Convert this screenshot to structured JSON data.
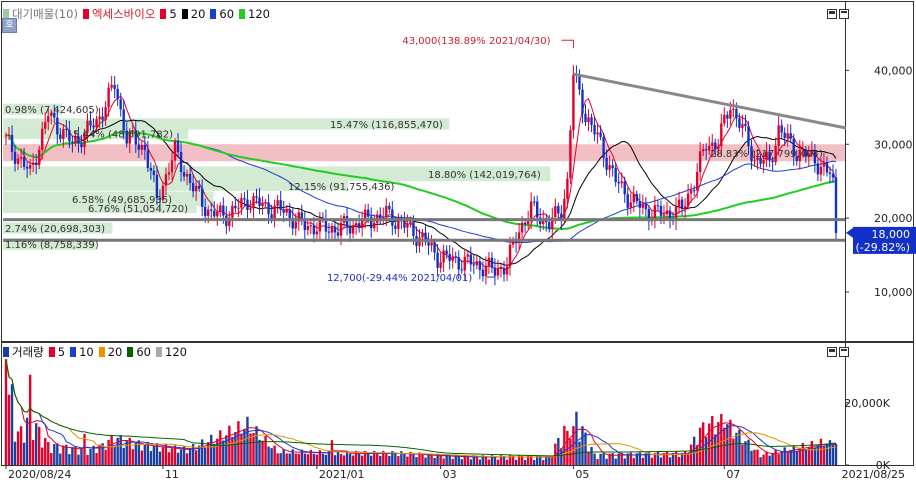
{
  "price_legend": [
    {
      "label": "대기매물(10)",
      "color": "#9ec89e"
    },
    {
      "label": "엑세스바이오",
      "color": "#e4002b"
    },
    {
      "label": "5",
      "color": "#e4002b"
    },
    {
      "label": "20",
      "color": "#000000"
    },
    {
      "label": "60",
      "color": "#1a3fd0"
    },
    {
      "label": "120",
      "color": "#22cc22"
    }
  ],
  "volume_legend": [
    {
      "label": "거래량",
      "color": "#1a3fa0"
    },
    {
      "label": "5",
      "color": "#e4002b"
    },
    {
      "label": "10",
      "color": "#1a3fd0"
    },
    {
      "label": "20",
      "color": "#e69500"
    },
    {
      "label": "60",
      "color": "#006600"
    },
    {
      "label": "120",
      "color": "#aaaaaa"
    }
  ],
  "side_tab": "호",
  "chart_data": [
    {
      "type": "candlestick",
      "title": "엑세스바이오",
      "y_ticks": [
        "10,000",
        "20,000",
        "30,000",
        "40,000"
      ],
      "y_tick_values": [
        10000,
        20000,
        30000,
        40000
      ],
      "ylim": [
        3500,
        47500
      ],
      "x_ticks": [
        "2020/08/24",
        "11",
        "2021/01",
        "03",
        "05",
        "07",
        "2021/08/25"
      ],
      "x_tick_index": [
        0,
        52,
        103,
        144,
        188,
        238,
        275
      ],
      "n_days": 275,
      "ohlc_path": [
        [
          0,
          30500
        ],
        [
          8,
          26000
        ],
        [
          14,
          34000
        ],
        [
          22,
          30000
        ],
        [
          30,
          33000
        ],
        [
          36,
          38000
        ],
        [
          40,
          31000
        ],
        [
          46,
          29500
        ],
        [
          50,
          22500
        ],
        [
          56,
          29000
        ],
        [
          62,
          24000
        ],
        [
          68,
          20500
        ],
        [
          74,
          20500
        ],
        [
          80,
          22500
        ],
        [
          86,
          21500
        ],
        [
          92,
          21000
        ],
        [
          98,
          19000
        ],
        [
          104,
          18800
        ],
        [
          110,
          18500
        ],
        [
          118,
          19500
        ],
        [
          126,
          20500
        ],
        [
          132,
          19000
        ],
        [
          138,
          17200
        ],
        [
          143,
          14800
        ],
        [
          150,
          14200
        ],
        [
          158,
          13500
        ],
        [
          162,
          12800
        ],
        [
          166,
          13800
        ],
        [
          170,
          18500
        ],
        [
          174,
          21200
        ],
        [
          180,
          19200
        ],
        [
          184,
          21000
        ],
        [
          186,
          25000
        ],
        [
          188,
          39500
        ],
        [
          192,
          34000
        ],
        [
          197,
          30000
        ],
        [
          202,
          25000
        ],
        [
          207,
          22500
        ],
        [
          212,
          21000
        ],
        [
          218,
          20500
        ],
        [
          224,
          21200
        ],
        [
          228,
          25000
        ],
        [
          232,
          30000
        ],
        [
          236,
          30200
        ],
        [
          240,
          35500
        ],
        [
          244,
          32000
        ],
        [
          248,
          28000
        ],
        [
          253,
          27500
        ],
        [
          256,
          32000
        ],
        [
          262,
          29000
        ],
        [
          268,
          28000
        ],
        [
          272,
          26000
        ],
        [
          273,
          18000
        ]
      ],
      "ma_lines": [
        {
          "period": "5",
          "color": "#e4002b",
          "lag": 3
        },
        {
          "period": "20",
          "color": "#000000",
          "lag": 10
        },
        {
          "period": "60",
          "color": "#1a3fd0",
          "lag": 30
        },
        {
          "period": "120",
          "color": "#22cc22",
          "lag": 60
        }
      ],
      "overlay_bands": [
        {
          "label": "0.98% (7,424,605)",
          "price_range": [
            34000,
            35500
          ],
          "width_frac": 0.07,
          "color": "#d3ead3"
        },
        {
          "label": "15.47% (116,855,470)",
          "price_range": [
            32000,
            33500
          ],
          "width_frac": 0.53,
          "color": "#d3ead3"
        },
        {
          "label": "5.44% (48,691,782)",
          "price_range": [
            30700,
            32200
          ],
          "width_frac": 0.22,
          "color": "#d3ead3"
        },
        {
          "label": "28.83% (217,799,404)",
          "price_range": [
            27700,
            30000
          ],
          "width_frac": 1.0,
          "color": "#f2c0c4"
        },
        {
          "label": "18.80% (142,019,764)",
          "price_range": [
            25000,
            27000
          ],
          "width_frac": 0.65,
          "color": "#d3ead3"
        },
        {
          "label": "6.58% (49,685,935)",
          "price_range": [
            21600,
            23600
          ],
          "width_frac": 0.25,
          "color": "#d3ead3"
        },
        {
          "label": "12.15% (91,755,436)",
          "price_range": [
            23700,
            25000
          ],
          "width_frac": 0.41,
          "color": "#d3ead3"
        },
        {
          "label": "6.76% (51,054,720)",
          "price_range": [
            20700,
            22100
          ],
          "width_frac": 0.23,
          "color": "#d3ead3"
        },
        {
          "label": "2.74% (20,698,303)",
          "price_range": [
            17900,
            19400
          ],
          "width_frac": 0.13,
          "color": "#d3ead3"
        },
        {
          "label": "1.16% (8,758,339)",
          "price_range": [
            15700,
            17300
          ],
          "width_frac": 0.11,
          "color": "#d3ead3"
        }
      ],
      "trend_line": {
        "from": [
          188,
          39500
        ],
        "to": [
          275,
          32200
        ],
        "color": "#888888"
      },
      "support_lines": [
        {
          "price": 19800,
          "color": "#777777"
        },
        {
          "price": 17000,
          "color": "#777777"
        }
      ],
      "annotations": [
        {
          "text": "43,000(138.89% 2021/04/30)",
          "x": 188,
          "y": 43000,
          "color": "#d0202b"
        },
        {
          "text": "12,700(-29.44% 2021/04/01)",
          "x": 162,
          "y": 12700,
          "color": "#1a2fc0"
        }
      ],
      "current_price": {
        "price": "18,000",
        "change": "(-29.82%)",
        "value": 18000,
        "bg": "#1230c8"
      }
    },
    {
      "type": "bar",
      "title": "거래량",
      "y_ticks": [
        "0K",
        "20,000K"
      ],
      "y_tick_values": [
        0,
        20000
      ],
      "ylim": [
        0,
        36000
      ],
      "volume_shape": [
        [
          0,
          22000
        ],
        [
          4,
          9000
        ],
        [
          8,
          14000
        ],
        [
          14,
          6000
        ],
        [
          22,
          5000
        ],
        [
          28,
          4500
        ],
        [
          36,
          8000
        ],
        [
          45,
          6000
        ],
        [
          60,
          4500
        ],
        [
          80,
          12000
        ],
        [
          90,
          4000
        ],
        [
          110,
          3500
        ],
        [
          130,
          3500
        ],
        [
          150,
          2500
        ],
        [
          180,
          2500
        ],
        [
          186,
          12000
        ],
        [
          188,
          16000
        ],
        [
          195,
          3000
        ],
        [
          225,
          3500
        ],
        [
          232,
          12000
        ],
        [
          238,
          13000
        ],
        [
          250,
          3000
        ],
        [
          273,
          7000
        ]
      ],
      "spikes": [
        [
          0,
          34000
        ],
        [
          2,
          26000
        ],
        [
          8,
          29000
        ],
        [
          26,
          10000
        ],
        [
          32,
          7000
        ],
        [
          80,
          15500
        ],
        [
          108,
          8000
        ],
        [
          140,
          3500
        ],
        [
          186,
          11000
        ],
        [
          188,
          12500
        ],
        [
          230,
          12000
        ],
        [
          232,
          9000
        ],
        [
          238,
          12000
        ],
        [
          273,
          8000
        ]
      ],
      "ma_lines": [
        {
          "period": "5",
          "color": "#e4002b",
          "lag": 3
        },
        {
          "period": "10",
          "color": "#1a3fd0",
          "lag": 6
        },
        {
          "period": "20",
          "color": "#e69500",
          "lag": 11
        },
        {
          "period": "60",
          "color": "#006600",
          "lag": 30
        }
      ]
    }
  ]
}
